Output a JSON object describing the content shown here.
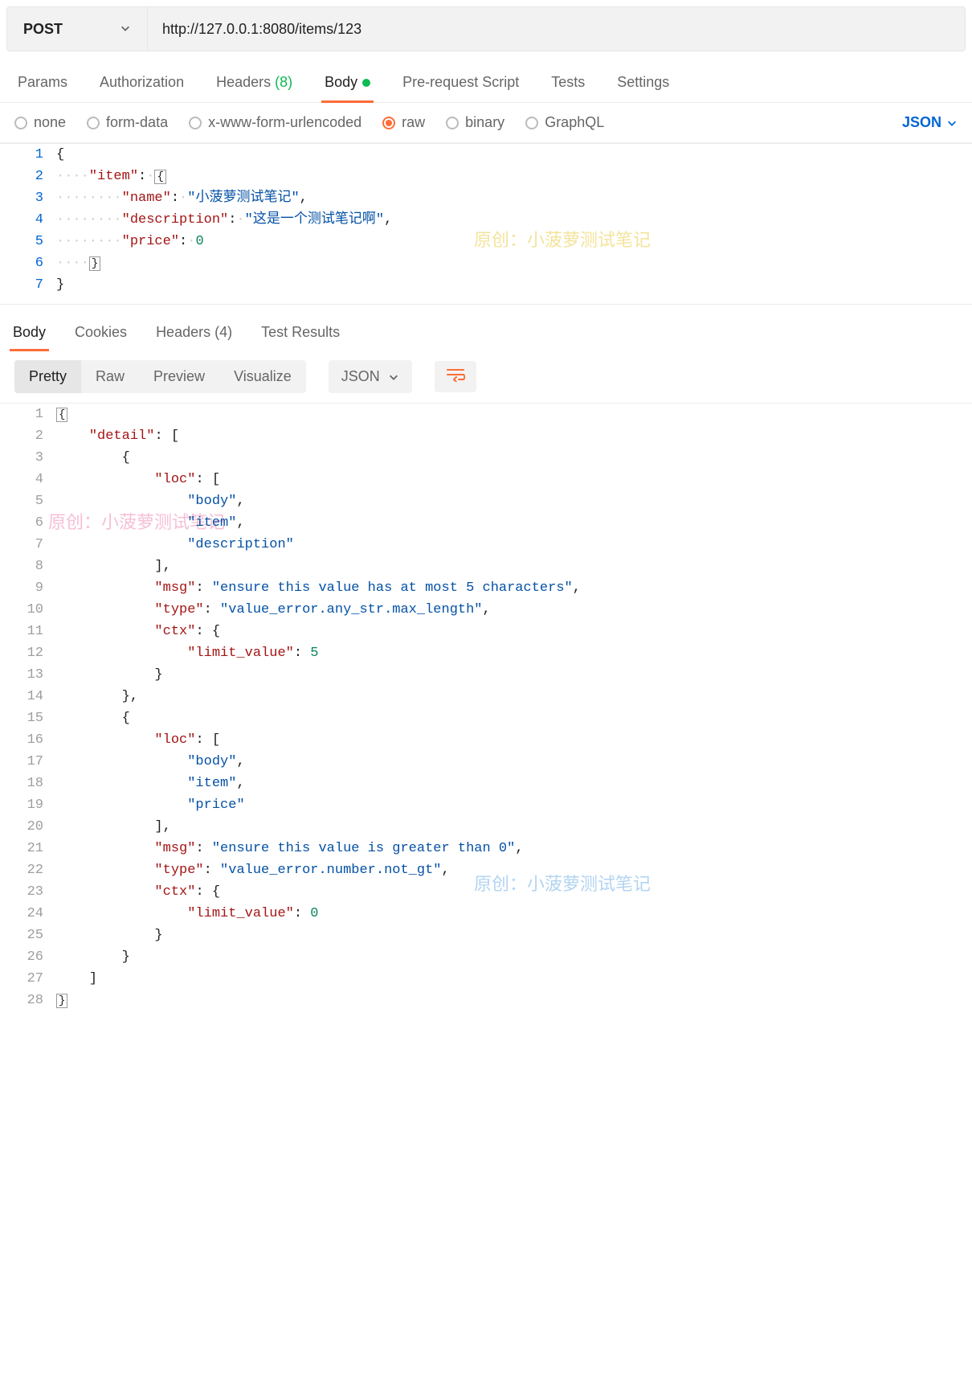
{
  "request": {
    "method": "POST",
    "url": "http://127.0.0.1:8080/items/123"
  },
  "request_tabs": [
    {
      "label": "Params",
      "active": false
    },
    {
      "label": "Authorization",
      "active": false
    },
    {
      "label": "Headers",
      "count": "(8)",
      "active": false
    },
    {
      "label": "Body",
      "active": true,
      "has_dot": true
    },
    {
      "label": "Pre-request Script",
      "active": false
    },
    {
      "label": "Tests",
      "active": false
    },
    {
      "label": "Settings",
      "active": false
    }
  ],
  "body_types": {
    "none": "none",
    "form_data": "form-data",
    "urlencoded": "x-www-form-urlencoded",
    "raw": "raw",
    "binary": "binary",
    "graphql": "GraphQL",
    "selected": "raw",
    "format": "JSON"
  },
  "request_body_lines": [
    {
      "n": 1,
      "html": "<span class='tok-punc'>{</span>"
    },
    {
      "n": 2,
      "html": "<span class='indent-guide'>····</span><span class='tok-key'>\"item\"</span><span class='tok-punc'>:</span><span class='indent-guide'>·</span><span class='tok-punc fold-box'>{</span>"
    },
    {
      "n": 3,
      "html": "<span class='indent-guide'>········</span><span class='tok-key'>\"name\"</span><span class='tok-punc'>:</span><span class='indent-guide'>·</span><span class='tok-str'>\"小菠萝测试笔记\"</span><span class='tok-punc'>,</span>"
    },
    {
      "n": 4,
      "html": "<span class='indent-guide'>········</span><span class='tok-key'>\"description\"</span><span class='tok-punc'>:</span><span class='indent-guide'>·</span><span class='tok-str'>\"这是一个测试笔记啊\"</span><span class='tok-punc'>,</span>"
    },
    {
      "n": 5,
      "html": "<span class='indent-guide'>········</span><span class='tok-key'>\"price\"</span><span class='tok-punc'>:</span><span class='indent-guide'>·</span><span class='tok-num'>0</span>"
    },
    {
      "n": 6,
      "html": "<span class='indent-guide'>····</span><span class='tok-punc fold-box'>}</span>"
    },
    {
      "n": 7,
      "html": "<span class='tok-punc'>}</span>"
    }
  ],
  "response_tabs": [
    {
      "label": "Body",
      "active": true
    },
    {
      "label": "Cookies",
      "active": false
    },
    {
      "label": "Headers",
      "count": "(4)",
      "active": false
    },
    {
      "label": "Test Results",
      "active": false
    }
  ],
  "response_toolbar": {
    "views": [
      "Pretty",
      "Raw",
      "Preview",
      "Visualize"
    ],
    "active_view": "Pretty",
    "format": "JSON"
  },
  "response_body_lines": [
    {
      "n": 1,
      "html": "<span class='tok-punc fold-box'>{</span>"
    },
    {
      "n": 2,
      "html": "    <span class='tok-key'>\"detail\"</span><span class='tok-punc'>:</span> <span class='tok-punc'>[</span>"
    },
    {
      "n": 3,
      "html": "        <span class='tok-punc'>{</span>"
    },
    {
      "n": 4,
      "html": "            <span class='tok-key'>\"loc\"</span><span class='tok-punc'>:</span> <span class='tok-punc'>[</span>"
    },
    {
      "n": 5,
      "html": "                <span class='tok-str'>\"body\"</span><span class='tok-punc'>,</span>"
    },
    {
      "n": 6,
      "html": "                <span class='tok-str'>\"item\"</span><span class='tok-punc'>,</span>"
    },
    {
      "n": 7,
      "html": "                <span class='tok-str'>\"description\"</span>"
    },
    {
      "n": 8,
      "html": "            <span class='tok-punc'>]</span><span class='tok-punc'>,</span>"
    },
    {
      "n": 9,
      "html": "            <span class='tok-key'>\"msg\"</span><span class='tok-punc'>:</span> <span class='tok-str'>\"ensure this value has at most 5 characters\"</span><span class='tok-punc'>,</span>"
    },
    {
      "n": 10,
      "html": "            <span class='tok-key'>\"type\"</span><span class='tok-punc'>:</span> <span class='tok-str'>\"value_error.any_str.max_length\"</span><span class='tok-punc'>,</span>"
    },
    {
      "n": 11,
      "html": "            <span class='tok-key'>\"ctx\"</span><span class='tok-punc'>:</span> <span class='tok-punc'>{</span>"
    },
    {
      "n": 12,
      "html": "                <span class='tok-key'>\"limit_value\"</span><span class='tok-punc'>:</span> <span class='tok-num'>5</span>"
    },
    {
      "n": 13,
      "html": "            <span class='tok-punc'>}</span>"
    },
    {
      "n": 14,
      "html": "        <span class='tok-punc'>}</span><span class='tok-punc'>,</span>"
    },
    {
      "n": 15,
      "html": "        <span class='tok-punc'>{</span>"
    },
    {
      "n": 16,
      "html": "            <span class='tok-key'>\"loc\"</span><span class='tok-punc'>:</span> <span class='tok-punc'>[</span>"
    },
    {
      "n": 17,
      "html": "                <span class='tok-str'>\"body\"</span><span class='tok-punc'>,</span>"
    },
    {
      "n": 18,
      "html": "                <span class='tok-str'>\"item\"</span><span class='tok-punc'>,</span>"
    },
    {
      "n": 19,
      "html": "                <span class='tok-str'>\"price\"</span>"
    },
    {
      "n": 20,
      "html": "            <span class='tok-punc'>]</span><span class='tok-punc'>,</span>"
    },
    {
      "n": 21,
      "html": "            <span class='tok-key'>\"msg\"</span><span class='tok-punc'>:</span> <span class='tok-str'>\"ensure this value is greater than 0\"</span><span class='tok-punc'>,</span>"
    },
    {
      "n": 22,
      "html": "            <span class='tok-key'>\"type\"</span><span class='tok-punc'>:</span> <span class='tok-str'>\"value_error.number.not_gt\"</span><span class='tok-punc'>,</span>"
    },
    {
      "n": 23,
      "html": "            <span class='tok-key'>\"ctx\"</span><span class='tok-punc'>:</span> <span class='tok-punc'>{</span>"
    },
    {
      "n": 24,
      "html": "                <span class='tok-key'>\"limit_value\"</span><span class='tok-punc'>:</span> <span class='tok-num'>0</span>"
    },
    {
      "n": 25,
      "html": "            <span class='tok-punc'>}</span>"
    },
    {
      "n": 26,
      "html": "        <span class='tok-punc'>}</span>"
    },
    {
      "n": 27,
      "html": "    <span class='tok-punc'>]</span>"
    },
    {
      "n": 28,
      "html": "<span class='tok-punc fold-box'>}</span>"
    }
  ],
  "watermarks": {
    "yellow": "原创：小菠萝测试笔记",
    "pink": "原创：小菠萝测试笔记",
    "blue": "原创：小菠萝测试笔记"
  }
}
